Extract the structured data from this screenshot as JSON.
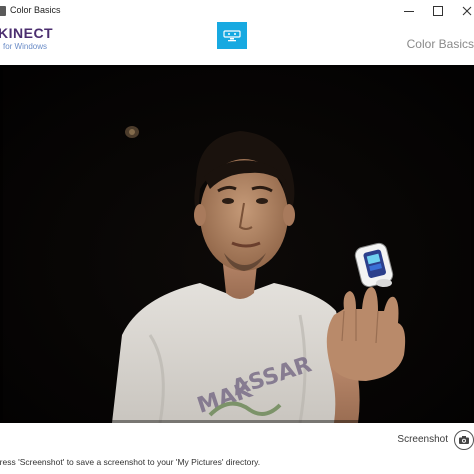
{
  "window": {
    "title": "Color Basics"
  },
  "header": {
    "brand": "KINECT",
    "brand_sub": "for Windows",
    "sensor_icon": "kinect-sensor-icon",
    "page_label": "Color Basics",
    "accent_color": "#17a9e1",
    "brand_color": "#4b2e6f"
  },
  "camera": {
    "content": "color-camera-feed"
  },
  "footer": {
    "screenshot_label": "Screenshot",
    "screenshot_icon": "camera-icon",
    "status_text": "Press 'Screenshot' to save a screenshot to your 'My Pictures' directory."
  }
}
